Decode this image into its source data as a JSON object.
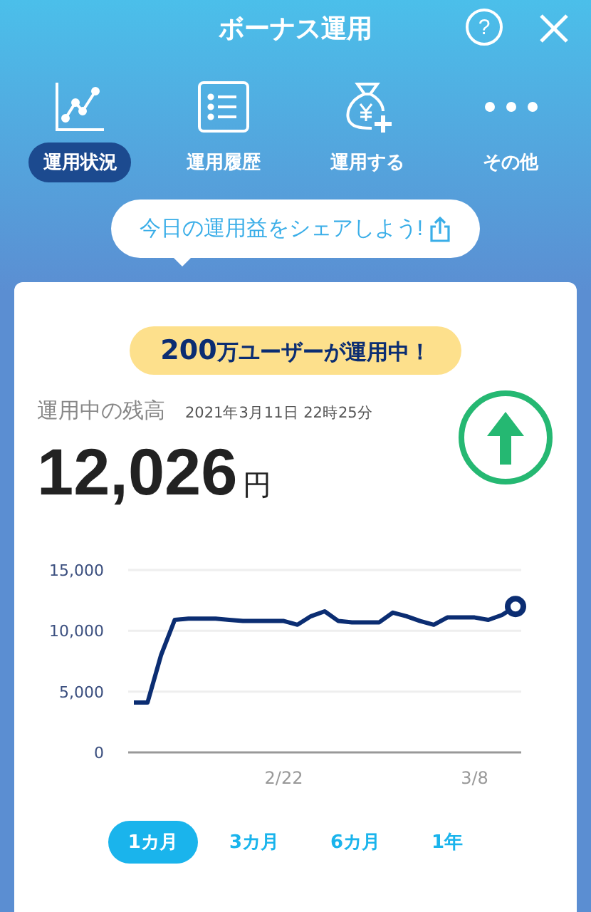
{
  "header": {
    "title": "ボーナス運用",
    "help": "?"
  },
  "nav": [
    {
      "kind": "chart",
      "label": "運用状況",
      "selected": true
    },
    {
      "kind": "list",
      "label": "運用履歴",
      "selected": false
    },
    {
      "kind": "bag",
      "label": "運用する",
      "selected": false
    },
    {
      "kind": "more",
      "label": "その他",
      "selected": false
    }
  ],
  "share": {
    "text": "今日の運用益をシェアしよう!"
  },
  "card": {
    "badge": "**200**万ユーザーが運用中！",
    "balance_label": "運用中の残高",
    "timestamp": "2021年3月11日 22時25分",
    "amount": "12,026",
    "unit": "円",
    "chart_data": {
      "type": "line",
      "categories": [
        null,
        null,
        null,
        null,
        null,
        null,
        null,
        null,
        null,
        null,
        null,
        "2/22",
        null,
        null,
        null,
        null,
        null,
        null,
        null,
        null,
        null,
        null,
        null,
        null,
        null,
        "3/8",
        null,
        null,
        null
      ],
      "series": [
        {
          "color": "#0b2d72",
          "values": [
            4100,
            4100,
            8000,
            10900,
            11000,
            11000,
            11000,
            10900,
            10800,
            10800,
            10800,
            10800,
            10500,
            11200,
            11600,
            10800,
            10700,
            10700,
            10700,
            11500,
            11200,
            10800,
            10500,
            11100,
            11100,
            11100,
            10900,
            11300,
            12000
          ]
        }
      ],
      "ylim": [
        0,
        15000
      ],
      "yticks": [
        {
          "value": 0,
          "label": "0"
        },
        {
          "value": 5000,
          "label": "5,000"
        },
        {
          "value": 10000,
          "label": "10,000"
        },
        {
          "value": 15000,
          "label": "15,000"
        }
      ]
    },
    "periods": [
      {
        "label": "1カ月",
        "selected": true
      },
      {
        "label": "3カ月",
        "selected": false
      },
      {
        "label": "6カ月",
        "selected": false
      },
      {
        "label": "1年",
        "selected": false
      }
    ]
  }
}
